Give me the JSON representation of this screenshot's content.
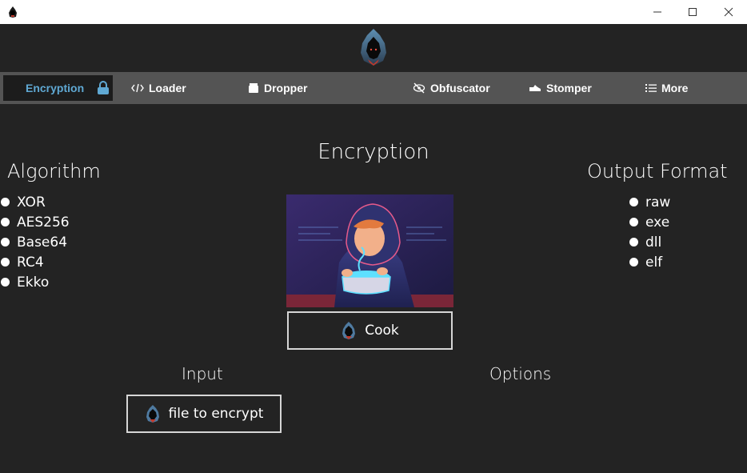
{
  "window": {
    "title": "",
    "controls": [
      "minimize",
      "maximize",
      "close"
    ]
  },
  "nav": {
    "items": [
      {
        "label": "Encryption",
        "icon": "lock-icon",
        "active": true
      },
      {
        "label": "Loader",
        "icon": "code-icon"
      },
      {
        "label": "Dropper",
        "icon": "box-icon"
      },
      {
        "label": "Obfuscator",
        "icon": "eye-slash-icon"
      },
      {
        "label": "Stomper",
        "icon": "shoe-icon"
      },
      {
        "label": "More",
        "icon": "list-icon"
      }
    ]
  },
  "main": {
    "title": "Encryption",
    "algorithm": {
      "title": "Algorithm",
      "options": [
        "XOR",
        "AES256",
        "Base64",
        "RC4",
        "Ekko"
      ]
    },
    "output_format": {
      "title": "Output Format",
      "options": [
        "raw",
        "exe",
        "dll",
        "elf"
      ]
    },
    "cook_button": "Cook",
    "input": {
      "title": "Input",
      "file_button": "file to encrypt"
    },
    "options": {
      "title": "Options"
    }
  },
  "colors": {
    "background": "#232323",
    "navbar": "#545454",
    "active_tab_bg": "#1c1c1c",
    "accent": "#5fa8d3",
    "button_border": "#d6d6d6"
  }
}
